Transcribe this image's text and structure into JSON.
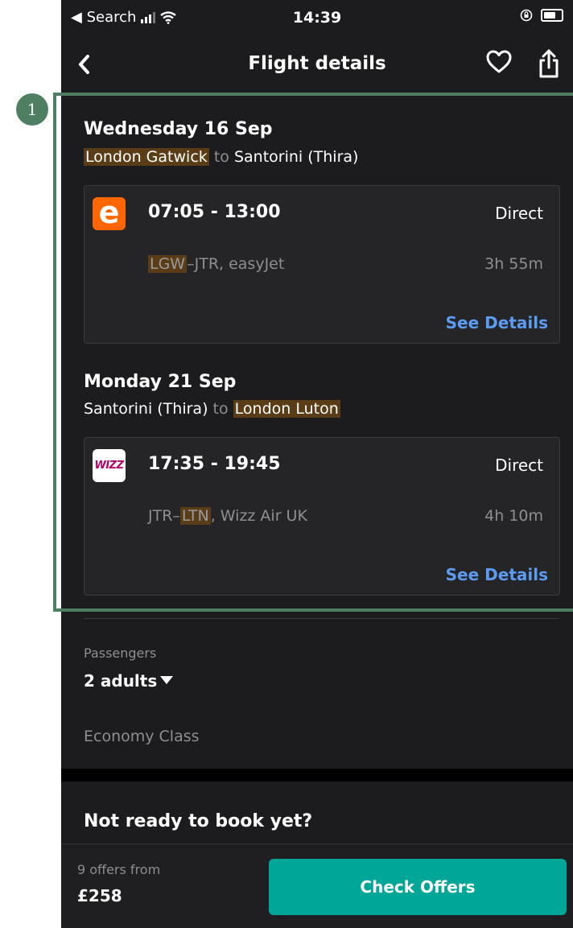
{
  "status_bar": {
    "back_app": "◀ Search",
    "time": "14:39"
  },
  "nav": {
    "title": "Flight details"
  },
  "outbound": {
    "date": "Wednesday 16 Sep",
    "origin": "London Gatwick",
    "to": "to",
    "destination": "Santorini (Thira)",
    "logo_text": "e",
    "times": "07:05 - 13:00",
    "stops": "Direct",
    "origin_code": "LGW",
    "dest_code_rest": "–JTR, easyJet",
    "duration": "3h 55m",
    "details_label": "See Details"
  },
  "inbound": {
    "date": "Monday 21 Sep",
    "origin": "Santorini (Thira)",
    "to": "to",
    "destination": "London Luton",
    "logo_text": "WIZZ",
    "times": "17:35 - 19:45",
    "stops": "Direct",
    "code_prefix": "JTR–",
    "dest_code": "LTN",
    "airline": ", Wizz Air UK",
    "duration": "4h 10m",
    "details_label": "See Details"
  },
  "passengers": {
    "label": "Passengers",
    "value": "2 adults",
    "cabin": "Economy Class"
  },
  "not_ready": "Not ready to book yet?",
  "bottom": {
    "offers_from": "9 offers from",
    "price": "£258",
    "button": "Check Offers"
  },
  "annotation": {
    "badge": "1"
  },
  "colors": {
    "accent": "#00a698",
    "link": "#5b9cf0",
    "highlight": "#5a3d16",
    "annotation": "#4f7f63"
  }
}
